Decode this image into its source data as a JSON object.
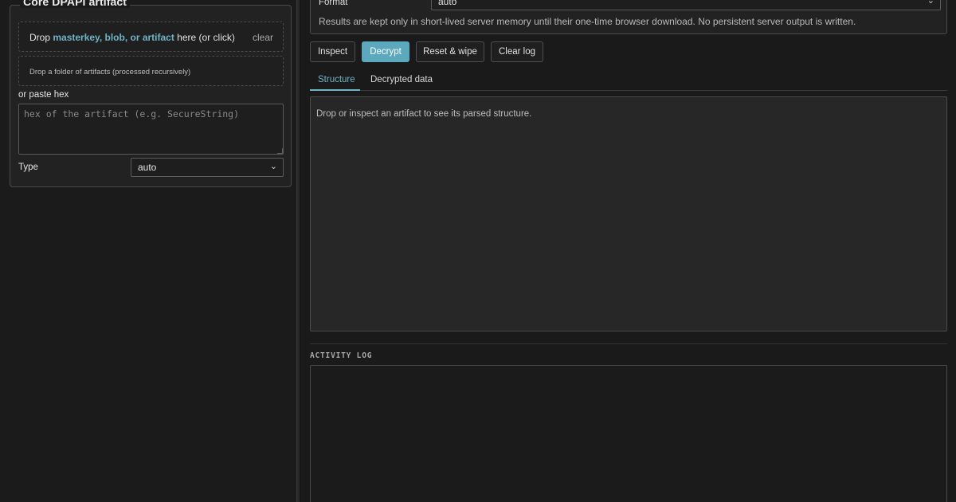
{
  "artifact": {
    "legend": "Core DPAPI artifact",
    "drop_prefix": "Drop ",
    "drop_highlight": "masterkey, blob, or artifact",
    "drop_suffix": " here (or click)",
    "clear_label": "clear",
    "folder_drop": "Drop a folder of artifacts (processed recursively)",
    "paste_label": "or paste hex",
    "hex_placeholder": "hex of the artifact (e.g. SecureString)",
    "hex_value": "",
    "type_label": "Type",
    "type_value": "auto"
  },
  "config": {
    "format_label": "Format",
    "format_value": "auto",
    "note": "Results are kept only in short-lived server memory until their one-time browser download. No persistent server output is written."
  },
  "toolbar": {
    "inspect": "Inspect",
    "decrypt": "Decrypt",
    "reset": "Reset & wipe",
    "clear_log": "Clear log"
  },
  "tabs": [
    {
      "label": "Structure",
      "active": true
    },
    {
      "label": "Decrypted data",
      "active": false
    }
  ],
  "structure": {
    "message": "Drop or inspect an artifact to see its parsed structure."
  },
  "log": {
    "title": "ACTIVITY LOG",
    "entries": []
  },
  "colors": {
    "accent": "#5ca9bd",
    "highlight": "#6fb3c7",
    "background": "#1a1a1a"
  }
}
